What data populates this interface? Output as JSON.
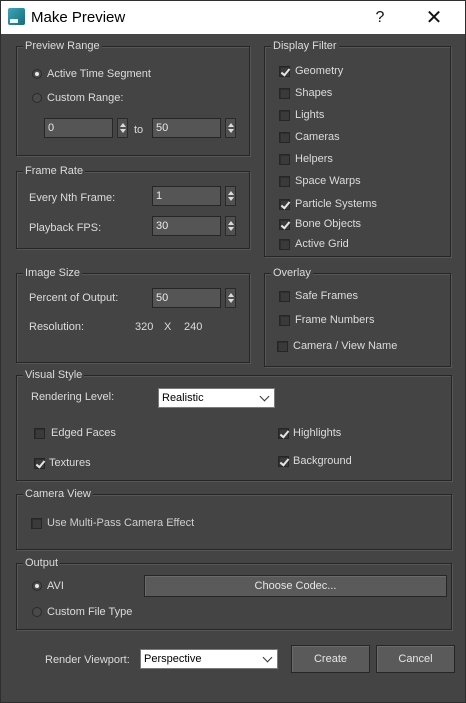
{
  "window": {
    "title": "Make Preview",
    "help_glyph": "?",
    "close_glyph": "✕"
  },
  "preview_range": {
    "title": "Preview Range",
    "active_time_segment": "Active Time Segment",
    "custom_range": "Custom Range:",
    "from_value": "0",
    "to_label": "to",
    "to_value": "50",
    "selected": "Active Time Segment"
  },
  "display_filter": {
    "title": "Display Filter",
    "items": [
      {
        "label": "Geometry",
        "checked": true
      },
      {
        "label": "Shapes",
        "checked": false
      },
      {
        "label": "Lights",
        "checked": false
      },
      {
        "label": "Cameras",
        "checked": false
      },
      {
        "label": "Helpers",
        "checked": false
      },
      {
        "label": "Space Warps",
        "checked": false
      },
      {
        "label": "Particle Systems",
        "checked": true
      },
      {
        "label": "Bone Objects",
        "checked": true
      },
      {
        "label": "Active Grid",
        "checked": false
      }
    ]
  },
  "frame_rate": {
    "title": "Frame Rate",
    "every_nth_label": "Every Nth Frame:",
    "every_nth_value": "1",
    "playback_fps_label": "Playback FPS:",
    "playback_fps_value": "30"
  },
  "image_size": {
    "title": "Image Size",
    "percent_label": "Percent of Output:",
    "percent_value": "50",
    "resolution_label": "Resolution:",
    "res_width": "320",
    "res_x": "X",
    "res_height": "240"
  },
  "overlay": {
    "title": "Overlay",
    "items": [
      {
        "label": "Safe Frames",
        "checked": false
      },
      {
        "label": "Frame Numbers",
        "checked": false
      },
      {
        "label": "Camera / View Name",
        "checked": false
      }
    ]
  },
  "visual_style": {
    "title": "Visual Style",
    "rendering_level_label": "Rendering Level:",
    "rendering_level_value": "Realistic",
    "edged_faces": {
      "label": "Edged Faces",
      "checked": false
    },
    "textures": {
      "label": "Textures",
      "checked": true
    },
    "highlights": {
      "label": "Highlights",
      "checked": true
    },
    "background": {
      "label": "Background",
      "checked": true
    }
  },
  "camera_view": {
    "title": "Camera View",
    "multipass": {
      "label": "Use Multi-Pass Camera Effect",
      "checked": false
    }
  },
  "output": {
    "title": "Output",
    "avi": "AVI",
    "custom_file_type": "Custom File Type",
    "choose_codec": "Choose Codec...",
    "selected": "AVI"
  },
  "footer": {
    "render_viewport_label": "Render Viewport:",
    "render_viewport_value": "Perspective",
    "create": "Create",
    "cancel": "Cancel"
  }
}
